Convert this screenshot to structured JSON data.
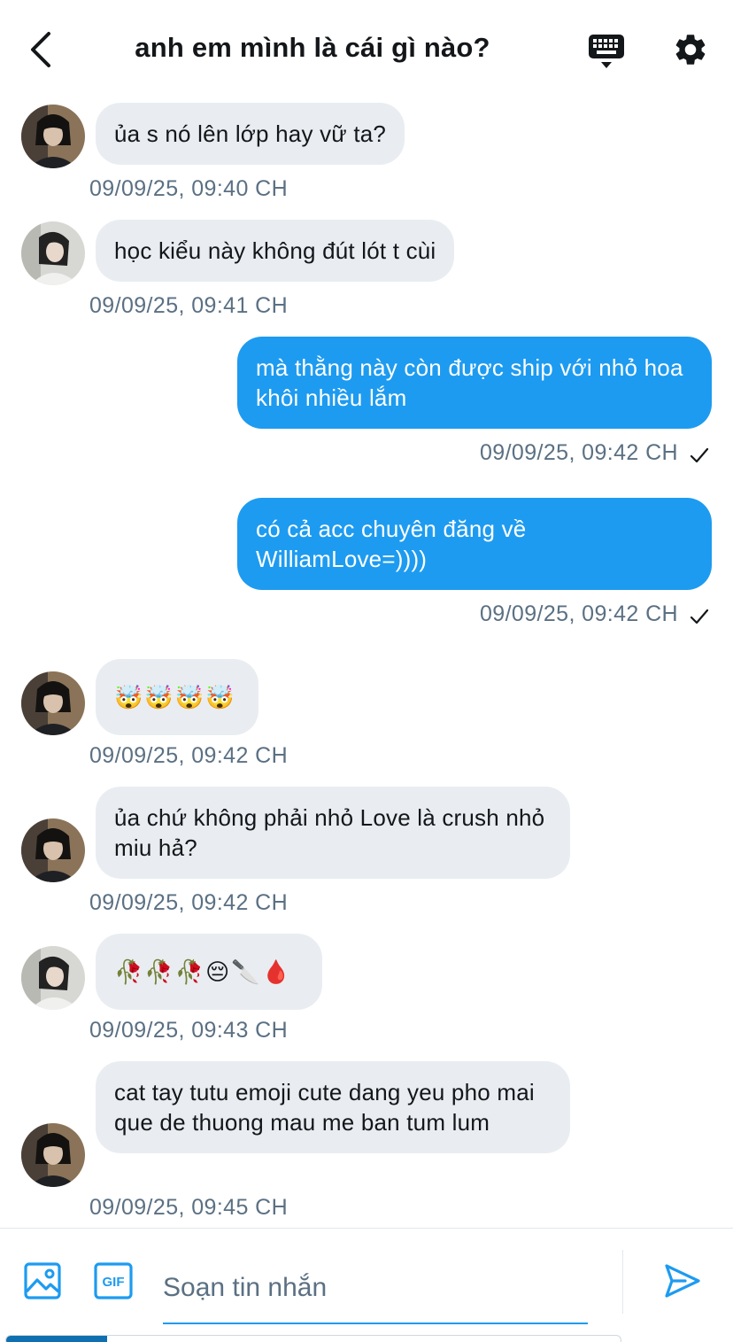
{
  "header": {
    "title": "anh em mình là cái gì nào?",
    "back_icon": "chevron-left-icon",
    "keyboard_icon": "keyboard-icon",
    "settings_icon": "gear-icon"
  },
  "messages": [
    {
      "dir": "in",
      "text": "ủa s nó lên lớp hay vữ ta?",
      "time": "09/09/25, 09:40 CH"
    },
    {
      "dir": "in",
      "text": "học kiểu này không đút lót t cùi",
      "time": "09/09/25, 09:41 CH"
    },
    {
      "dir": "out",
      "text": "mà thằng này còn được ship với nhỏ hoa khôi nhiều lắm",
      "time": "09/09/25, 09:42 CH",
      "status_icon": "check-icon"
    },
    {
      "dir": "out",
      "text": "có cả acc chuyên đăng về WilliamLove=))))",
      "time": "09/09/25, 09:42 CH",
      "status_icon": "check-icon"
    },
    {
      "dir": "in",
      "text": "🤯🤯🤯🤯",
      "time": "09/09/25, 09:42 CH"
    },
    {
      "dir": "in",
      "text": "ủa chứ không phải nhỏ Love là crush nhỏ miu hả?",
      "time": "09/09/25, 09:42 CH"
    },
    {
      "dir": "in",
      "text": "🥀🥀🥀😔🔪🩸",
      "time": "09/09/25, 09:43 CH"
    },
    {
      "dir": "in",
      "text": "cat tay tutu emoji cute dang yeu pho mai que de thuong mau me ban tum lum",
      "time": "09/09/25, 09:45 CH"
    }
  ],
  "composer": {
    "placeholder": "Soạn tin nhắn",
    "value": "",
    "image_icon": "image-icon",
    "gif_icon": "gif-icon",
    "send_icon": "send-icon"
  },
  "colors": {
    "accent": "#1d9bf0",
    "incoming_bubble": "#e9edf1",
    "timestamp": "#5b7083",
    "text": "#14171a"
  }
}
